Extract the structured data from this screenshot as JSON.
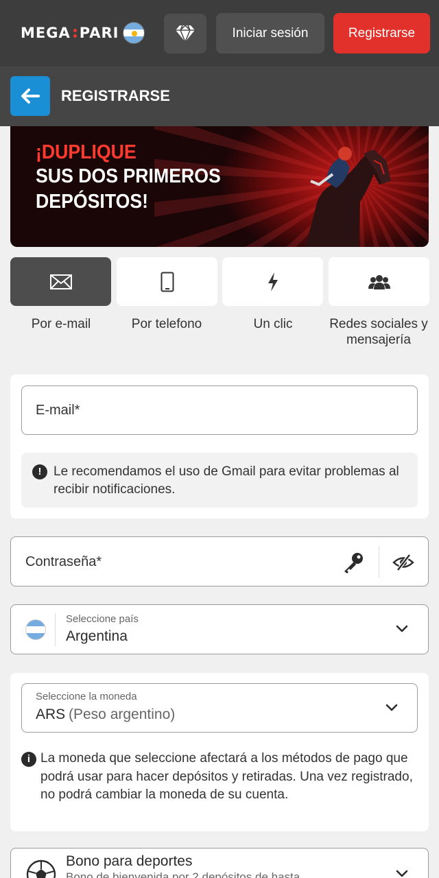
{
  "header": {
    "logo_left": "MEGA",
    "logo_right": "PARI",
    "login_label": "Iniciar sesión",
    "register_label": "Registrarse",
    "icons": [
      "diamond-icon",
      "argentina-flag-icon"
    ]
  },
  "subheader": {
    "title": "REGISTRARSE",
    "back_icon": "arrow-left-icon"
  },
  "banner": {
    "line1": "¡DUPLIQUE",
    "line2": "SUS DOS PRIMEROS",
    "line3": "DEPÓSITOS!"
  },
  "methods": [
    {
      "label": "Por e-mail",
      "icon": "envelope-icon",
      "active": true
    },
    {
      "label": "Por telefono",
      "icon": "phone-icon",
      "active": false
    },
    {
      "label": "Un clic",
      "icon": "lightning-icon",
      "active": false
    },
    {
      "label": "Redes sociales y mensajería",
      "icon": "users-icon",
      "active": false
    }
  ],
  "email": {
    "placeholder": "E-mail*",
    "hint": "Le recomendamos el uso de Gmail para evitar problemas al recibir notificaciones."
  },
  "password": {
    "placeholder": "Contraseña*"
  },
  "country": {
    "label": "Seleccione país",
    "value": "Argentina"
  },
  "currency": {
    "label": "Seleccione la moneda",
    "code": "ARS",
    "name": "(Peso argentino)",
    "hint": "La moneda que seleccione afectará a los métodos de pago que podrá usar para hacer depósitos y retiradas. Una vez registrado, no podrá cambiar la moneda de su cuenta."
  },
  "bonus": {
    "title": "Bono para deportes",
    "subtitle": "Bono de bienvenida por 2 depósitos de hasta"
  },
  "colors": {
    "brand_red": "#e2312b",
    "back_blue": "#1b8fd6",
    "header_dark": "#3d3d3d"
  }
}
